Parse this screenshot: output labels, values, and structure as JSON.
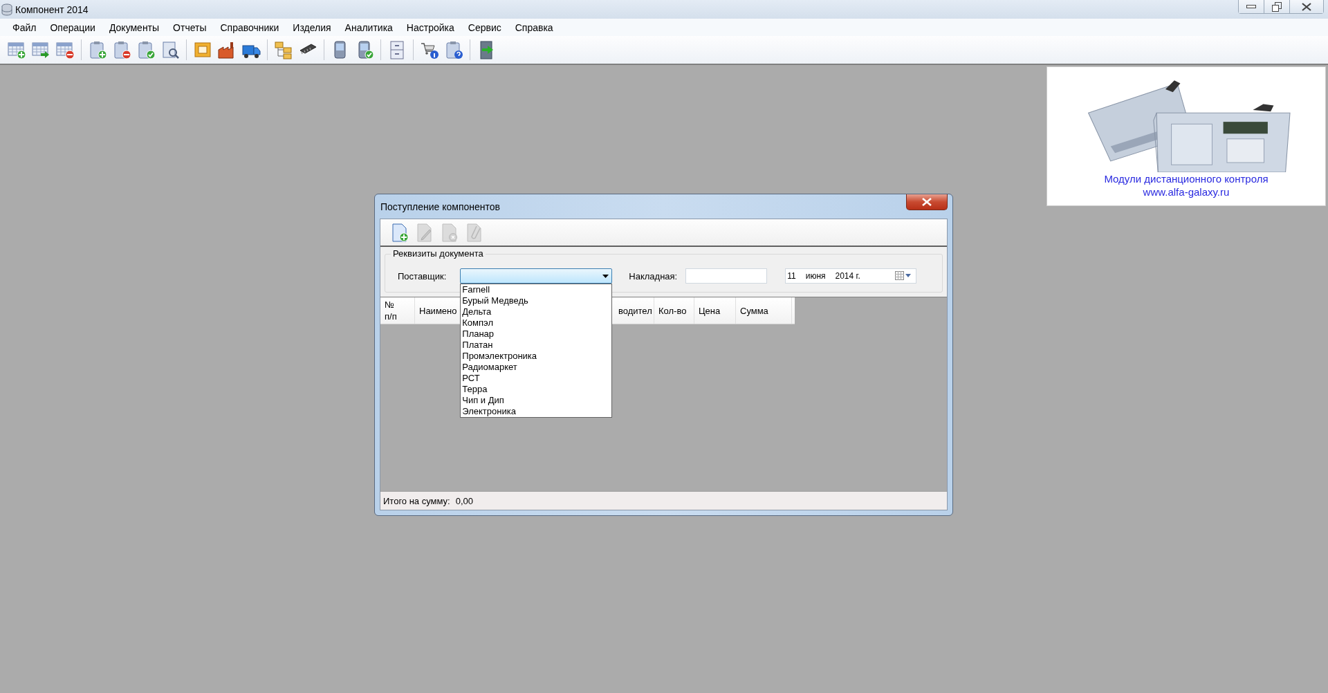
{
  "window": {
    "title": "Компонент 2014"
  },
  "menu": [
    {
      "label": "Файл"
    },
    {
      "label": "Операции"
    },
    {
      "label": "Документы"
    },
    {
      "label": "Отчеты"
    },
    {
      "label": "Справочники"
    },
    {
      "label": "Изделия"
    },
    {
      "label": "Аналитика"
    },
    {
      "label": "Настройка"
    },
    {
      "label": "Сервис"
    },
    {
      "label": "Справка"
    }
  ],
  "ad": {
    "caption": "Модули дистанционного контроля",
    "url": "www.alfa-galaxy.ru"
  },
  "dialog": {
    "title": "Поступление компонентов",
    "toolbar": [
      {
        "disabled": false
      },
      {
        "disabled": true
      },
      {
        "disabled": true
      },
      {
        "disabled": true
      }
    ],
    "group_title": "Реквизиты документа",
    "supplier": {
      "label": "Поставщик:",
      "open": true,
      "options": [
        "Farnell",
        "Бурый Медведь",
        "Дельта",
        "Компэл",
        "Планар",
        "Платан",
        "Промэлектроника",
        "Радиомаркет",
        "РСТ",
        "Терра",
        "Чип и Дип",
        "Электроника"
      ]
    },
    "invoice": {
      "label": "Накладная:"
    },
    "date": {
      "day": "11",
      "month": "июня",
      "year": "2014 г."
    },
    "table": {
      "columns": [
        "№ п/п",
        "Наимено",
        "водител",
        "Кол-во",
        "Цена",
        "Сумма"
      ]
    },
    "total": {
      "label": "Итого на сумму:",
      "value": "0,00"
    }
  }
}
